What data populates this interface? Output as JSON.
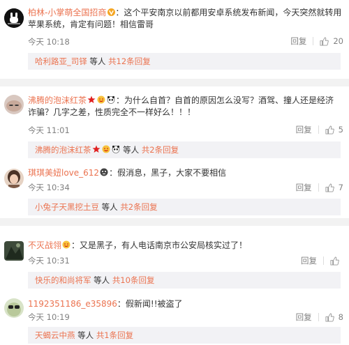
{
  "comments": [
    {
      "user": "柏林-小掌萌全国招商",
      "content": "：这个平安南京以前都用安卓系统发布新闻，今天突然就转用苹果系统，肯定有问题！相信雷哥",
      "time": "今天 10:18",
      "reply_label": "回复",
      "likes": "20",
      "reply_thread": {
        "users": "哈利路亚_司铎",
        "suffix": " 等人 ",
        "count": "共12条回复"
      }
    },
    {
      "user": "沸腾的泡沫红茶",
      "content": "：为什么自首？自首的原因怎么没写？酒驾、撞人还是经济诈骗？几字之差，性质完全不一样好么！！！",
      "time": "今天 11:01",
      "reply_label": "回复",
      "likes": "5",
      "reply_thread": {
        "users": "沸腾的泡沫红茶",
        "suffix": " 等人 ",
        "count": "共2条回复"
      }
    },
    {
      "user": "琪琪美妞love_612",
      "content": "：假消息，黑子，大家不要相信",
      "time": "今天 10:34",
      "reply_label": "回复",
      "likes": "7",
      "reply_thread": {
        "users": "小兔子天黑挖土豆",
        "suffix": " 等人 ",
        "count": "共2条回复"
      }
    },
    {
      "user": "不灭战翎",
      "content": "：又是黑子，有人电话南京市公安局核实过了！",
      "time": "今天 10:31",
      "reply_label": "回复",
      "likes": "",
      "reply_thread": {
        "users": "快乐的和尚将军",
        "suffix": " 等人 ",
        "count": "共10条回复"
      }
    },
    {
      "user": "1192351186_e35896",
      "content": "：假新闻!!被盗了",
      "time": "今天 10:19",
      "reply_label": "回复",
      "likes": "8",
      "reply_thread": {
        "users": "天蝎云中燕",
        "suffix": " 等人 ",
        "count": "共1条回复"
      }
    }
  ],
  "icons": {
    "like": "thumbs-up-icon",
    "vip": "vip-v-icon",
    "star": "red-star-icon",
    "emoji": "emoji-icon"
  },
  "colors": {
    "link": "#eb7350",
    "muted": "#808080",
    "reply_bg": "#f2f2f5",
    "separator": "#f2f2f2"
  }
}
